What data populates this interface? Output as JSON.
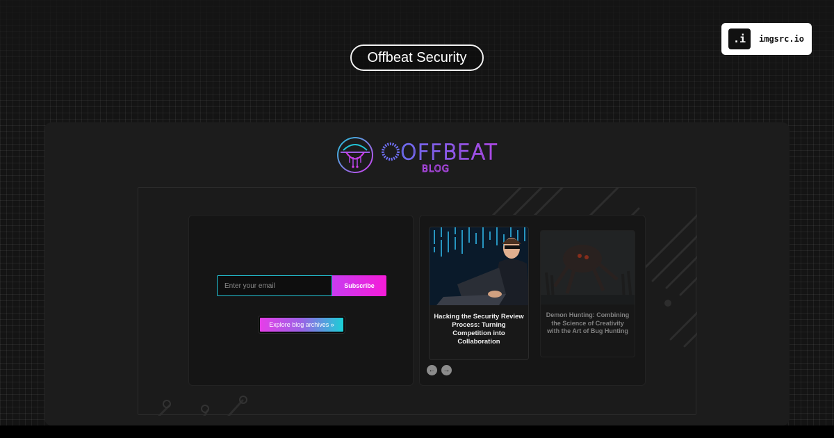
{
  "site_title": "Offbeat Security",
  "badge": {
    "icon_text": ".i",
    "label": "imgsrc.io"
  },
  "logo": {
    "word": "OFFBEAT",
    "sub": "BLOG",
    "colors": {
      "purple": "#9b5de5",
      "cyan": "#22c4d6",
      "magenta": "#d43cf0"
    }
  },
  "subscribe": {
    "placeholder": "Enter your email",
    "button_label": "Subscribe"
  },
  "archive_button_label": "Explore blog archives »",
  "posts": [
    {
      "title": "Hacking the Security Review Process: Turning Competition into Collaboration",
      "image": "hacker-laptop-image"
    },
    {
      "title": "Demon Hunting: Combining the Science of Creativity with the Art of Bug Hunting",
      "image": "demon-creature-image"
    }
  ],
  "carousel": {
    "prev_icon": "arrow-left-icon",
    "next_icon": "arrow-right-icon"
  }
}
